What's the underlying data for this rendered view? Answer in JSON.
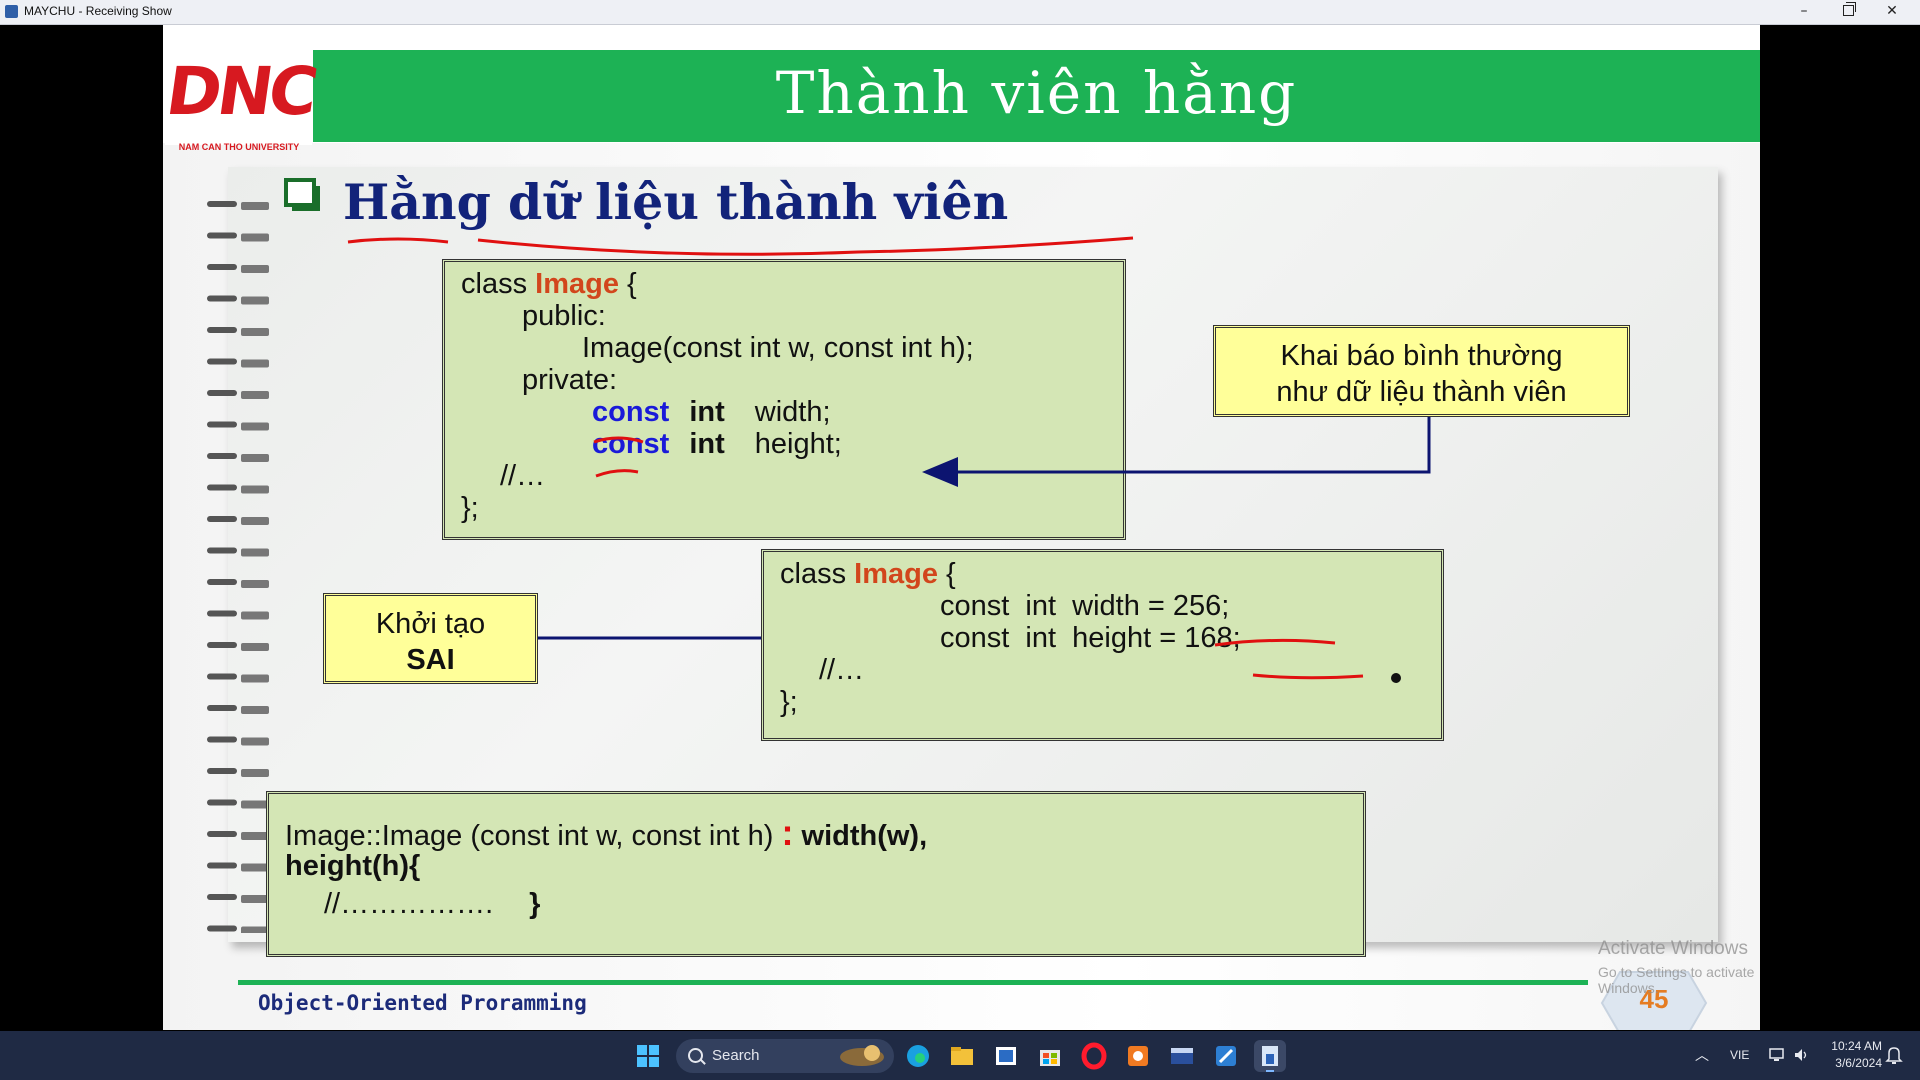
{
  "window": {
    "title": "MAYCHU - Receiving Show",
    "minimize_glyph": "–",
    "close_glyph": "✕"
  },
  "slide": {
    "title": "Thành viên hằng",
    "logo_text": "DNC",
    "logo_subtitle": "NAM CAN THO UNIVERSITY",
    "heading": "Hằng dữ liệu thành viên",
    "code1": {
      "l1_a": "class ",
      "l1_b": "Image",
      "l1_c": " {",
      "l2": "public:",
      "l3": "Image(const int w, const int h);",
      "l4": "private:",
      "l5_a": "const",
      "l5_b": "int",
      "l5_c": "width;",
      "l6_a": "const",
      "l6_b": "int",
      "l6_c": "height;",
      "l7": "//…",
      "l8": "};"
    },
    "callout1": {
      "line1": "Khai báo bình thường",
      "line2": "như dữ liệu thành viên"
    },
    "callout2": {
      "line1": "Khởi tạo",
      "line2": "SAI"
    },
    "code2": {
      "l1_a": "class ",
      "l1_b": "Image",
      "l1_c": " {",
      "l2": "const  int  width = 256;",
      "l3": "const  int  height = 168;",
      "l4": "//…",
      "l5": "};"
    },
    "code3": {
      "l1_a": "Image::Image (const int w, const int h) ",
      "l1_colon": ":",
      "l1_b": " width(w),",
      "l2": "height(h){",
      "l3_a": "//…………….",
      "l3_b": "}"
    },
    "footer": "Object-Oriented Proramming",
    "page_number": "45",
    "watermark_title": "Activate Windows",
    "watermark_sub": "Go to Settings to activate Windows."
  },
  "taskbar": {
    "search_label": "Search",
    "language": "VIE",
    "time": "10:24 AM",
    "date": "3/6/2024"
  },
  "colors": {
    "header_green": "#1db255",
    "code_bg": "#d4e6b5",
    "callout_bg": "#ffff99",
    "heading_blue": "#12237a",
    "keyword_red": "#d2461c",
    "keyword_blue": "#1a1ad9",
    "taskbar": "#1f2a44"
  }
}
